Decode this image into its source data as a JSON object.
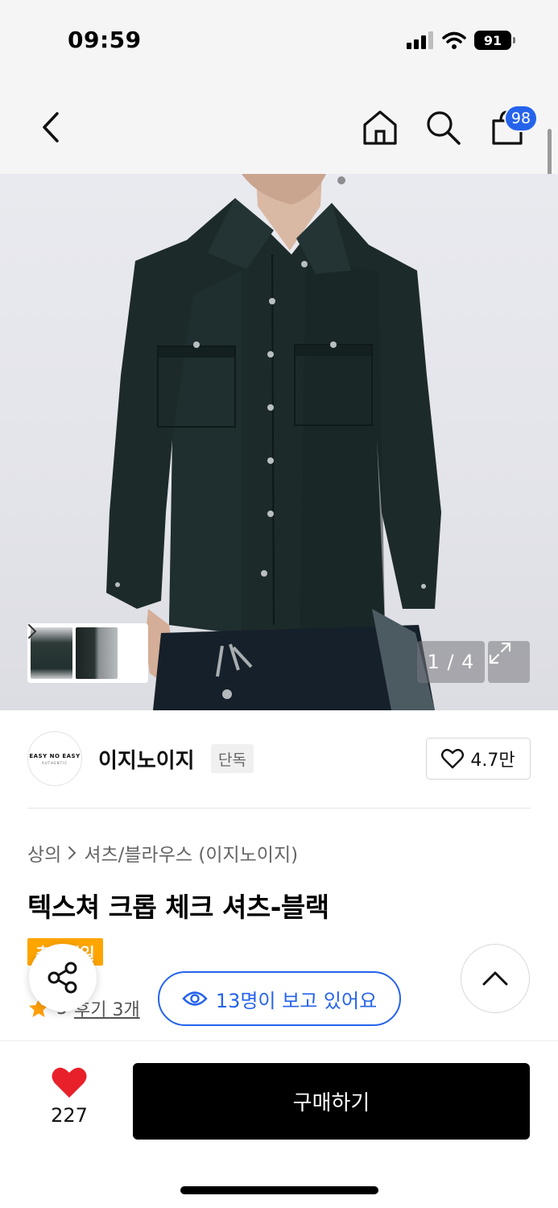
{
  "status_bar": {
    "time": "09:59",
    "battery": "91"
  },
  "nav": {
    "cart_count": "98"
  },
  "gallery": {
    "page_indicator": "1 / 4"
  },
  "brand": {
    "logo_line1": "EASY NO EASY",
    "logo_line2": "AUTHENTIC",
    "name": "이지노이지",
    "exclusive_label": "단독",
    "likes": "4.7만"
  },
  "product": {
    "breadcrumb_category": "상의",
    "breadcrumb_sub": "셔츠/블라우스 (이지노이지)",
    "title": "텍스쳐 크롭 체크 셔츠-블랙",
    "sale_tag": "추가세일",
    "rating": "5",
    "review_label": "후기 3개"
  },
  "viewers": {
    "text": "13명이 보고 있어요"
  },
  "bottom_bar": {
    "wish_count": "227",
    "buy_label": "구매하기"
  },
  "colors": {
    "accent_blue": "#2563eb",
    "sale_orange": "#ffa500",
    "heart_red": "#e8202a",
    "star_orange": "#ff9f0a"
  }
}
